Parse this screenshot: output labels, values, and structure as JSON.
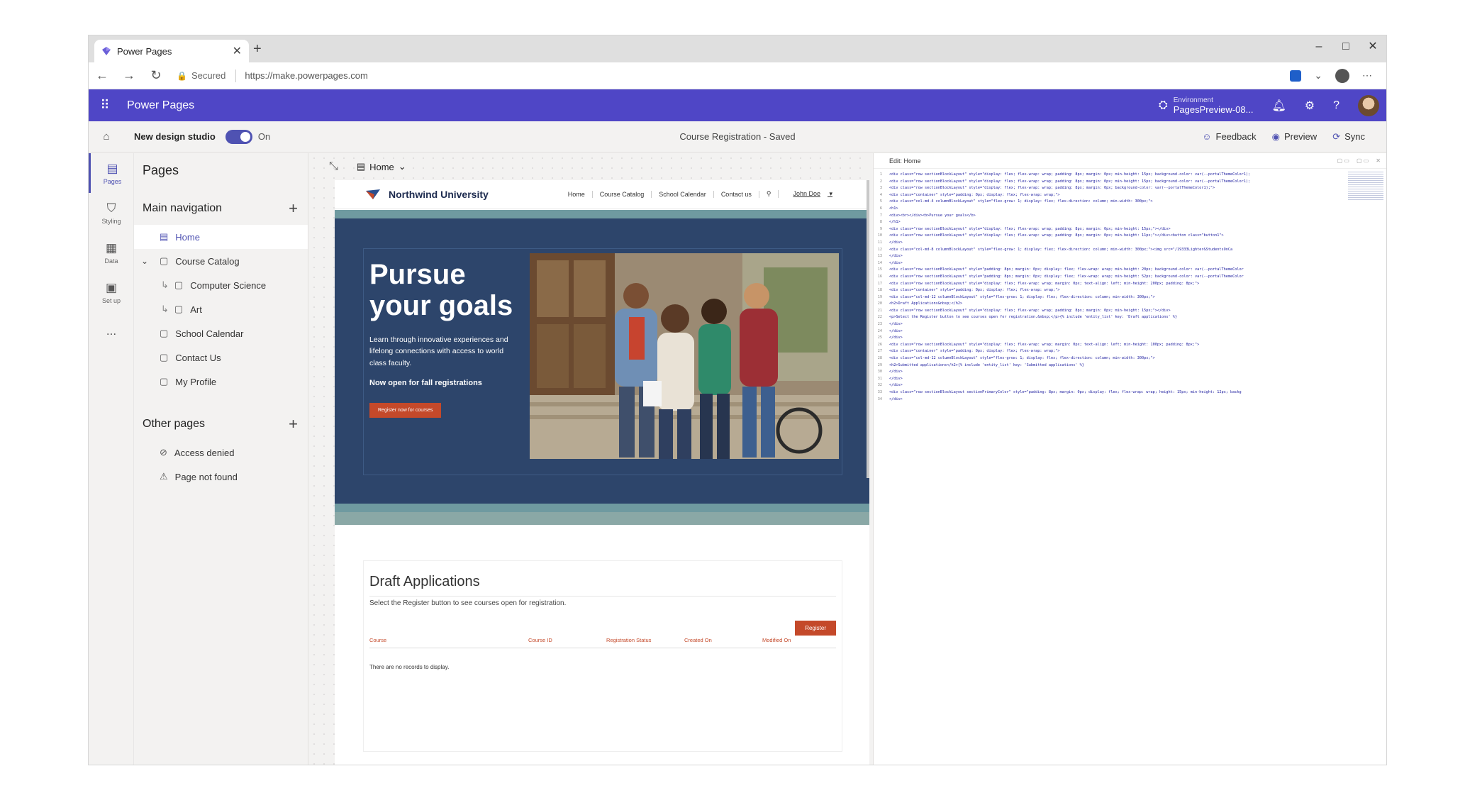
{
  "browser": {
    "tab_title": "Power Pages",
    "new_tab": "+",
    "address_secured": "Secured",
    "url": "https://make.powerpages.com"
  },
  "app": {
    "name": "Power Pages",
    "env_label": "Environment",
    "env_name": "PagesPreview-08..."
  },
  "commandbar": {
    "new_design_studio": "New design studio",
    "toggle_state": "On",
    "doc_title": "Course Registration - Saved",
    "feedback": "Feedback",
    "preview": "Preview",
    "sync": "Sync"
  },
  "rail": [
    {
      "label": "Pages",
      "icon": "page-icon"
    },
    {
      "label": "Styling",
      "icon": "brush-icon"
    },
    {
      "label": "Data",
      "icon": "table-icon"
    },
    {
      "label": "Set up",
      "icon": "setup-icon"
    },
    {
      "label": "...",
      "icon": "more-icon"
    }
  ],
  "pages_panel": {
    "title": "Pages",
    "main_nav_title": "Main navigation",
    "other_pages_title": "Other pages",
    "main_nav": [
      {
        "label": "Home"
      },
      {
        "label": "Course Catalog"
      },
      {
        "label": "Computer Science"
      },
      {
        "label": "Art"
      },
      {
        "label": "School Calendar"
      },
      {
        "label": "Contact Us"
      },
      {
        "label": "My Profile"
      }
    ],
    "other_pages": [
      {
        "label": "Access denied"
      },
      {
        "label": "Page not found"
      }
    ]
  },
  "canvas": {
    "page_selector": "Home",
    "site": {
      "name": "Northwind University",
      "nav_links": [
        "Home",
        "Course Catalog",
        "School Calendar",
        "Contact us"
      ],
      "user": "John Doe",
      "hero_title": "Pursue your goals",
      "hero_desc": "Learn through innovative experiences and lifelong connections with access to world class faculty.",
      "hero_open": "Now open for fall registrations",
      "hero_button": "Register now for courses",
      "draft_title": "Draft Applications",
      "draft_desc": "Select the Register button to see courses open for registration.",
      "register_button": "Register",
      "columns": [
        "Course",
        "Course ID",
        "Registration Status",
        "Created On",
        "Modified On"
      ],
      "no_records": "There are no records to display."
    }
  },
  "editor": {
    "title": "Edit: Home",
    "lines": [
      "<div class=\"row sectionBlockLayout\" style=\"display: flex; flex-wrap: wrap; padding: 8px; margin: 0px; min-height: 15px; background-color: var(--portalThemeColor1);",
      "<div class=\"row sectionBlockLayout\" style=\"display: flex; flex-wrap: wrap; padding: 8px; margin: 0px; min-height: 15px; background-color: var(--portalThemeColor1);",
      "<div class=\"row sectionBlockLayout\" style=\"display: flex; flex-wrap: wrap; padding: 8px; margin: 0px; background-color: var(--portalThemeColor1);\">",
      "  <div class=\"container\" style=\"padding: 0px; display: flex; flex-wrap: wrap;\">",
      "    <div class=\"col-md-4 columnBlockLayout\" style=\"flex-grow: 1; display: flex; flex-direction: column; min-width: 300px;\">",
      "      <h1>",
      "        <div><br></div><b>Pursue your goals</b>",
      "      </h1>",
      "      <div class=\"row sectionBlockLayout\" style=\"display: flex; flex-wrap: wrap; padding: 8px; margin: 0px; min-height: 15px;\"></div>",
      "      <div class=\"row sectionBlockLayout\" style=\"display: flex; flex-wrap: wrap; padding: 8px; margin: 0px; min-height: 11px;\"></div><button class=\"button1\">",
      "    </div>",
      "    <div class=\"col-md-8 columnBlockLayout\" style=\"flex-grow: 1; display: flex; flex-direction: column; min-width: 300px;\"><img src=\"/19333Lighter&StudentsOnCa",
      "  </div>",
      "</div>",
      "<div class=\"row sectionBlockLayout\" style=\"padding: 8px; margin: 0px; display: flex; flex-wrap: wrap; min-height: 20px; background-color: var(--portalThemeColor",
      "<div class=\"row sectionBlockLayout\" style=\"padding: 8px; margin: 0px; display: flex; flex-wrap: wrap; min-height: 52px; background-color: var(--portalThemeColor",
      "<div class=\"row sectionBlockLayout\" style=\"display: flex; flex-wrap: wrap; margin: 0px; text-align: left; min-height: 200px; padding: 8px;\">",
      "  <div class=\"container\" style=\"padding: 0px; display: flex; flex-wrap: wrap;\">",
      "    <div class=\"col-md-12 columnBlockLayout\" style=\"flex-grow: 1; display: flex; flex-direction: column; min-width: 300px;\">",
      "      <h2>Draft Applications&nbsp;</h2>",
      "      <div class=\"row sectionBlockLayout\" style=\"display: flex; flex-wrap: wrap; padding: 8px; margin: 0px; min-height: 15px;\"></div>",
      "      <p>Select the Register button to see courses open for registration.&nbsp;</p>{% include 'entity_list' key: 'Draft applications' %}",
      "    </div>",
      "  </div>",
      "</div>",
      "<div class=\"row sectionBlockLayout\" style=\"display: flex; flex-wrap: wrap; margin: 0px; text-align: left; min-height: 100px; padding: 8px;\">",
      "  <div class=\"container\" style=\"padding: 0px; display: flex; flex-wrap: wrap;\">",
      "    <div class=\"col-md-12 columnBlockLayout\" style=\"flex-grow: 1; display: flex; flex-direction: column; min-width: 300px;\">",
      "      <h2>Submitted applications</h2>{% include 'entity_list' key: 'Submitted applications' %}",
      "    </div>",
      "  </div>",
      "</div>",
      "<div class=\"row sectionBlockLayout sectionPrimaryColor\" style=\"padding: 8px; margin: 0px; display: flex; flex-wrap: wrap; height: 15px; min-height: 12px; backg",
      "</div>"
    ]
  }
}
